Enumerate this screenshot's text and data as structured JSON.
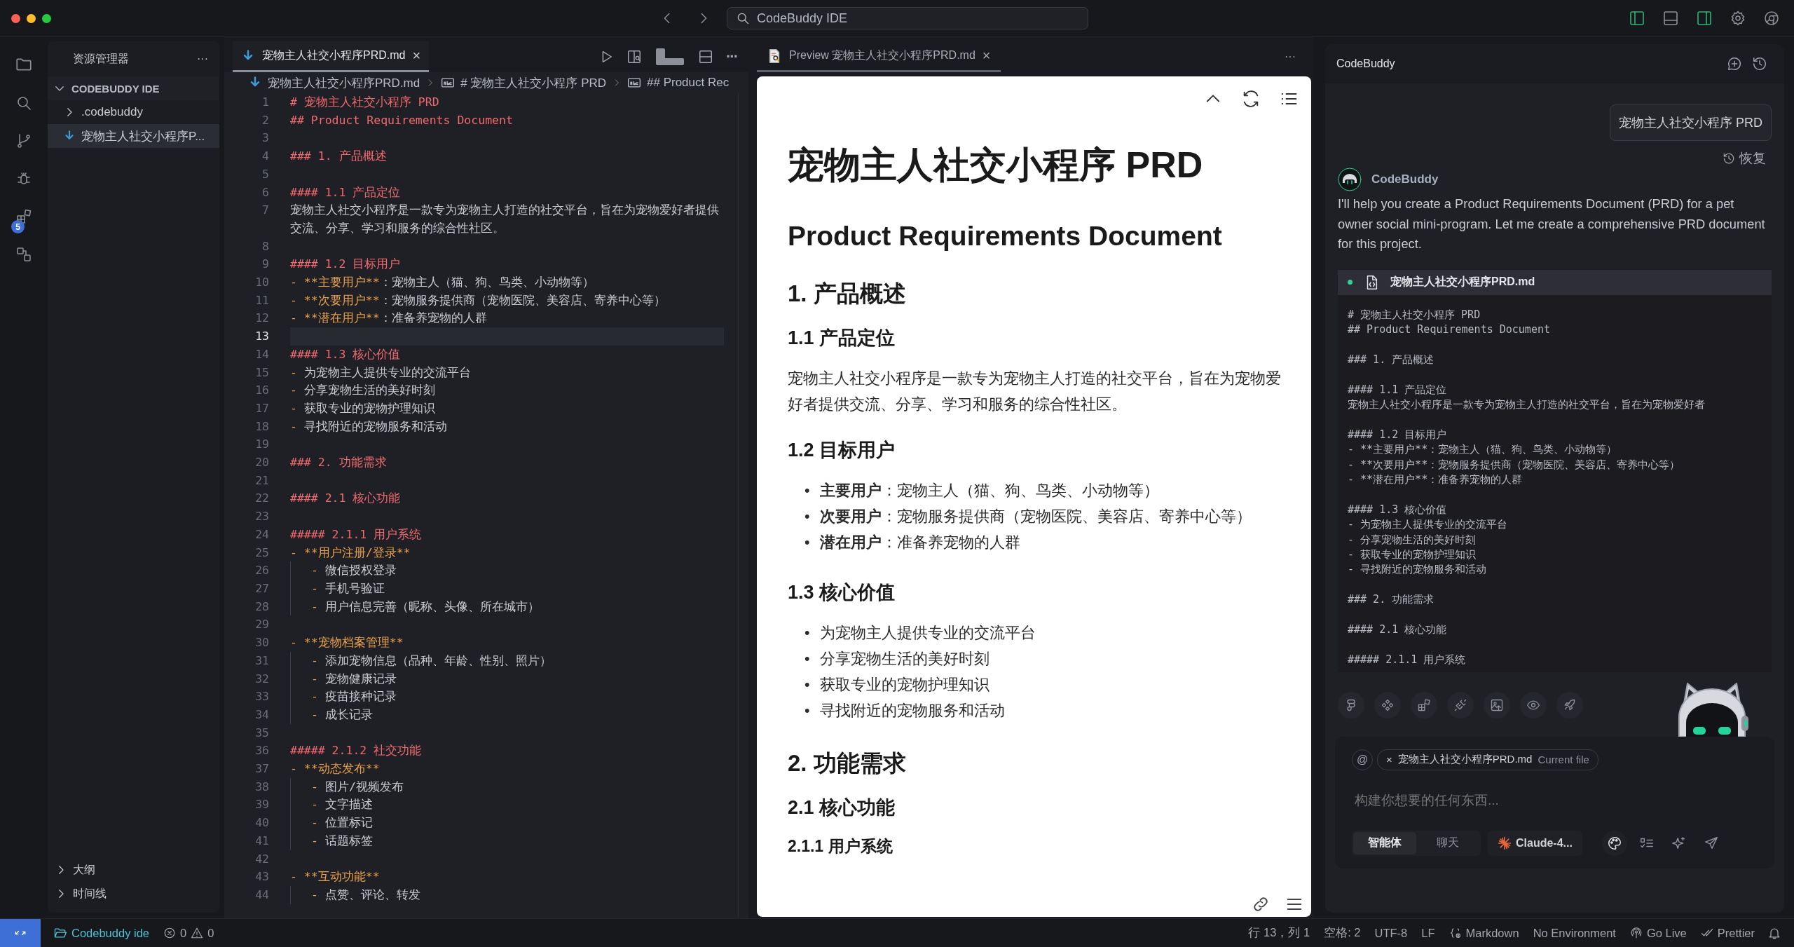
{
  "title_bar": {
    "search": "CodeBuddy IDE",
    "layout_toggles": [
      {
        "on": true
      },
      {
        "on": false
      },
      {
        "on": true
      }
    ]
  },
  "activity_bar": {
    "extensions_badge": "5"
  },
  "explorer": {
    "title": "资源管理器",
    "more": "···",
    "root": {
      "label": "CODEBUDDY IDE",
      "expanded": true,
      "children": [
        {
          "label": ".codebuddy",
          "kind": "folder",
          "expanded": false,
          "selected": false
        },
        {
          "label": "宠物主人社交小程序P...",
          "kind": "file",
          "selected": true
        }
      ]
    },
    "sections": [
      {
        "label": "大纲",
        "expanded": false
      },
      {
        "label": "时间线",
        "expanded": false
      }
    ]
  },
  "editor": {
    "tab": {
      "label": "宠物主人社交小程序PRD.md",
      "close": "×"
    },
    "more": "···",
    "breadcrumbs": [
      {
        "kind": "file",
        "text": "宠物主人社交小程序PRD.md"
      },
      {
        "kind": "symbol",
        "text": "# 宠物主人社交小程序 PRD"
      },
      {
        "kind": "symbol",
        "text": "## Product Rec"
      }
    ],
    "lines": [
      {
        "num": "1",
        "kind": "heading",
        "text": "# 宠物主人社交小程序 PRD",
        "current": false
      },
      {
        "num": "2",
        "kind": "heading",
        "text": "## Product Requirements Document",
        "current": false
      },
      {
        "num": "3",
        "kind": "blank",
        "current": false
      },
      {
        "num": "4",
        "kind": "heading",
        "text": "### 1. 产品概述",
        "current": false
      },
      {
        "num": "5",
        "kind": "blank",
        "current": false
      },
      {
        "num": "6",
        "kind": "heading",
        "text": "#### 1.1 产品定位",
        "current": false
      },
      {
        "num": "7",
        "kind": "plain",
        "text": "宠物主人社交小程序是一款专为宠物主人打造的社交平台，旨在为宠物爱好者提供交流、分享、学习和服务的综合性社区。",
        "current": false
      },
      {
        "num": "8",
        "kind": "blank",
        "current": false
      },
      {
        "num": "9",
        "kind": "heading",
        "text": "#### 1.2 目标用户",
        "current": false
      },
      {
        "num": "10",
        "kind": "marked",
        "marker": "- **主要用户**",
        "text": "：宠物主人（猫、狗、鸟类、小动物等）",
        "current": false
      },
      {
        "num": "11",
        "kind": "marked",
        "marker": "- **次要用户**",
        "text": "：宠物服务提供商（宠物医院、美容店、寄养中心等）",
        "current": false
      },
      {
        "num": "12",
        "kind": "marked",
        "marker": "- **潜在用户**",
        "text": "：准备养宠物的人群",
        "current": false
      },
      {
        "num": "13",
        "kind": "blank",
        "current": true
      },
      {
        "num": "14",
        "kind": "heading",
        "text": "#### 1.3 核心价值",
        "current": false
      },
      {
        "num": "15",
        "kind": "marked",
        "marker": "- ",
        "text": "为宠物主人提供专业的交流平台",
        "current": false
      },
      {
        "num": "16",
        "kind": "marked",
        "marker": "- ",
        "text": "分享宠物生活的美好时刻",
        "current": false
      },
      {
        "num": "17",
        "kind": "marked",
        "marker": "- ",
        "text": "获取专业的宠物护理知识",
        "current": false
      },
      {
        "num": "18",
        "kind": "marked",
        "marker": "- ",
        "text": "寻找附近的宠物服务和活动",
        "current": false
      },
      {
        "num": "19",
        "kind": "blank",
        "current": false
      },
      {
        "num": "20",
        "kind": "heading",
        "text": "### 2. 功能需求",
        "current": false
      },
      {
        "num": "21",
        "kind": "blank",
        "current": false
      },
      {
        "num": "22",
        "kind": "heading",
        "text": "#### 2.1 核心功能",
        "current": false
      },
      {
        "num": "23",
        "kind": "blank",
        "current": false
      },
      {
        "num": "24",
        "kind": "heading",
        "text": "##### 2.1.1 用户系统",
        "current": false
      },
      {
        "num": "25",
        "kind": "lead",
        "text": "- **用户注册/登录**",
        "current": false
      },
      {
        "num": "26",
        "kind": "sub",
        "marker": "- ",
        "text": "微信授权登录",
        "current": false
      },
      {
        "num": "27",
        "kind": "sub",
        "marker": "- ",
        "text": "手机号验证",
        "current": false
      },
      {
        "num": "28",
        "kind": "sub",
        "marker": "- ",
        "text": "用户信息完善（昵称、头像、所在城市）",
        "current": false
      },
      {
        "num": "29",
        "kind": "blank",
        "current": false
      },
      {
        "num": "30",
        "kind": "lead",
        "text": "- **宠物档案管理**",
        "current": false
      },
      {
        "num": "31",
        "kind": "sub",
        "marker": "- ",
        "text": "添加宠物信息（品种、年龄、性别、照片）",
        "current": false
      },
      {
        "num": "32",
        "kind": "sub",
        "marker": "- ",
        "text": "宠物健康记录",
        "current": false
      },
      {
        "num": "33",
        "kind": "sub",
        "marker": "- ",
        "text": "疫苗接种记录",
        "current": false
      },
      {
        "num": "34",
        "kind": "sub",
        "marker": "- ",
        "text": "成长记录",
        "current": false
      },
      {
        "num": "35",
        "kind": "blank",
        "current": false
      },
      {
        "num": "36",
        "kind": "heading",
        "text": "##### 2.1.2 社交功能",
        "current": false
      },
      {
        "num": "37",
        "kind": "lead",
        "text": "- **动态发布**",
        "current": false
      },
      {
        "num": "38",
        "kind": "sub",
        "marker": "- ",
        "text": "图片/视频发布",
        "current": false
      },
      {
        "num": "39",
        "kind": "sub",
        "marker": "- ",
        "text": "文字描述",
        "current": false
      },
      {
        "num": "40",
        "kind": "sub",
        "marker": "- ",
        "text": "位置标记",
        "current": false
      },
      {
        "num": "41",
        "kind": "sub",
        "marker": "- ",
        "text": "话题标签",
        "current": false
      },
      {
        "num": "42",
        "kind": "blank",
        "current": false
      },
      {
        "num": "43",
        "kind": "lead",
        "text": "- **互动功能**",
        "current": false
      },
      {
        "num": "44",
        "kind": "sub",
        "marker": "- ",
        "text": "点赞、评论、转发",
        "current": false
      }
    ]
  },
  "preview": {
    "tab": {
      "label": "Preview 宠物主人社交小程序PRD.md",
      "close": "×"
    },
    "more": "···",
    "blocks": [
      {
        "kind": "h1",
        "text": "宠物主人社交小程序 PRD"
      },
      {
        "kind": "h2",
        "text": "Product Requirements Document"
      },
      {
        "kind": "h3",
        "text": "1. 产品概述"
      },
      {
        "kind": "h4",
        "text": "1.1 产品定位"
      },
      {
        "kind": "p",
        "text": "宠物主人社交小程序是一款专为宠物主人打造的社交平台，旨在为宠物爱好者提供交流、分享、学习和服务的综合性社区。"
      },
      {
        "kind": "h4",
        "text": "1.2 目标用户"
      },
      {
        "kind": "ul",
        "bullet": "•",
        "items": [
          "**主要用户**：宠物主人（猫、狗、鸟类、小动物等）",
          "**次要用户**：宠物服务提供商（宠物医院、美容店、寄养中心等）",
          "**潜在用户**：准备养宠物的人群"
        ]
      },
      {
        "kind": "h4",
        "text": "1.3 核心价值"
      },
      {
        "kind": "ul",
        "bullet": "•",
        "items": [
          "为宠物主人提供专业的交流平台",
          "分享宠物生活的美好时刻",
          "获取专业的宠物护理知识",
          "寻找附近的宠物服务和活动"
        ]
      },
      {
        "kind": "h3",
        "text": "2. 功能需求"
      },
      {
        "kind": "h4",
        "text": "2.1 核心功能"
      },
      {
        "kind": "h5",
        "text": "2.1.1 用户系统"
      }
    ]
  },
  "chat": {
    "title": "CodeBuddy",
    "user_message": "宠物主人社交小程序 PRD",
    "restore": "恢复",
    "assistant": "CodeBuddy",
    "reply": "I'll help you create a Product Requirements Document (PRD) for a pet owner social mini-program. Let me create a comprehensive PRD document for this project.",
    "file": {
      "name": "宠物主人社交小程序PRD.md",
      "groups": [
        [
          "# 宠物主人社交小程序 PRD",
          "## Product Requirements Document"
        ],
        [
          "### 1. 产品概述"
        ],
        [
          "#### 1.1 产品定位",
          "宠物主人社交小程序是一款专为宠物主人打造的社交平台，旨在为宠物爱好者"
        ],
        [
          "#### 1.2 目标用户",
          "- **主要用户**：宠物主人（猫、狗、鸟类、小动物等）",
          "- **次要用户**：宠物服务提供商（宠物医院、美容店、寄养中心等）",
          "- **潜在用户**：准备养宠物的人群"
        ],
        [
          "#### 1.3 核心价值",
          "- 为宠物主人提供专业的交流平台",
          "- 分享宠物生活的美好时刻",
          "- 获取专业的宠物护理知识",
          "- 寻找附近的宠物服务和活动"
        ],
        [
          "### 2. 功能需求"
        ],
        [
          "#### 2.1 核心功能"
        ],
        [
          "##### 2.1.1 用户系统"
        ]
      ]
    },
    "input": {
      "at": "@",
      "chip_close": "×",
      "chip_file": "宠物主人社交小程序PRD.md",
      "chip_note": "Current file",
      "placeholder": "构建你想要的任何东西...",
      "modes": [
        {
          "label": "智能体",
          "selected": true
        },
        {
          "label": "聊天",
          "selected": false
        }
      ],
      "model": "Claude-4..."
    }
  },
  "status_bar": {
    "folder": "Codebuddy ide",
    "errors": "0",
    "warnings": "0",
    "items": [
      "行 13，列 1",
      "空格: 2",
      "UTF-8",
      "LF",
      "Markdown",
      "No Environment",
      "Go Live",
      "Prettier"
    ]
  }
}
